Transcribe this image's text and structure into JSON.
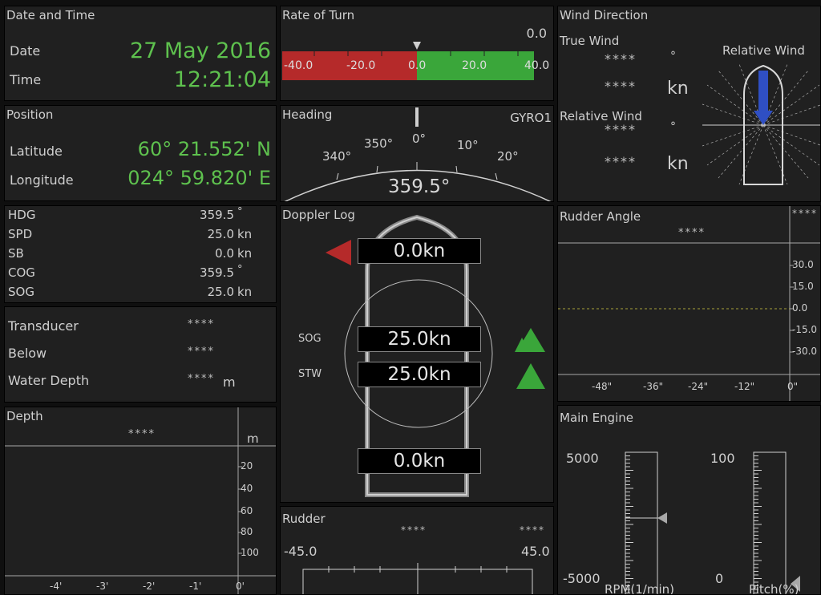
{
  "date_time": {
    "title": "Date and Time",
    "date_label": "Date",
    "date_value": "27 May 2016",
    "time_label": "Time",
    "time_value": "12:21:04"
  },
  "rate_of_turn": {
    "title": "Rate of Turn",
    "value": "0.0",
    "ticks": [
      "-40.0",
      "-20.0",
      "0.0",
      "20.0",
      "40.0"
    ],
    "bar_value": 0.0,
    "range": [
      -40,
      40
    ]
  },
  "wind": {
    "title": "Wind Direction",
    "true_label": "True Wind",
    "true_dir": "****",
    "deg": "°",
    "true_speed": "****",
    "unit": "kn",
    "rel_label": "Relative Wind",
    "rel_dir": "****",
    "rel_speed": "****",
    "rel_graphic_label": "Relative Wind"
  },
  "position": {
    "title": "Position",
    "lat_label": "Latitude",
    "lat_value": "60° 21.552' N",
    "lon_label": "Longitude",
    "lon_value": "024° 59.820' E"
  },
  "heading": {
    "title": "Heading",
    "source": "GYRO1",
    "value": "359.5°",
    "ticks": [
      "340°",
      "350°",
      "0°",
      "10°",
      "20°"
    ]
  },
  "nav": {
    "rows": [
      {
        "label": "HDG",
        "value": "359.5",
        "unit": "°"
      },
      {
        "label": "SPD",
        "value": "25.0",
        "unit": "kn"
      },
      {
        "label": "SB",
        "value": "0.0",
        "unit": "kn"
      },
      {
        "label": "COG",
        "value": "359.5",
        "unit": "°"
      },
      {
        "label": "SOG",
        "value": "25.0",
        "unit": "kn"
      }
    ]
  },
  "doppler": {
    "title": "Doppler Log",
    "bow": "0.0kn",
    "sog_label": "SOG",
    "sog": "25.0kn",
    "stw_label": "STW",
    "stw": "25.0kn",
    "stern": "0.0kn"
  },
  "rudder_angle": {
    "title": "Rudder Angle",
    "top": "****",
    "value": "****",
    "y_ticks": [
      "30.0",
      "15.0",
      "0.0",
      "-15.0",
      "-30.0"
    ],
    "x_ticks": [
      "-48\"",
      "-36\"",
      "-24\"",
      "-12\"",
      "0\""
    ]
  },
  "transducer": {
    "row1_label": "Transducer",
    "row1_value": "****",
    "row2_label": "Below",
    "row2_value": "****",
    "row3_label": "Water Depth",
    "row3_value": "****",
    "row3_unit": "m"
  },
  "depth": {
    "title": "Depth",
    "value": "****",
    "unit": "m",
    "y_ticks": [
      "20",
      "40",
      "60",
      "80",
      "100"
    ],
    "x_ticks": [
      "-4'",
      "-3'",
      "-2'",
      "-1'",
      "0'"
    ]
  },
  "main_engine": {
    "title": "Main Engine",
    "rpm_max": "5000",
    "rpm_min": "-5000",
    "rpm_label": "RPM(1/min)",
    "pitch_max": "100",
    "pitch_min": "0",
    "pitch_label": "Pitch(%)",
    "rpm_value": 0,
    "pitch_value": 0
  },
  "rudder": {
    "title": "Rudder",
    "value_left": "****",
    "value_right": "****",
    "left": "-45.0",
    "right": "45.0"
  },
  "colors": {
    "green": "#5ec14e",
    "red": "#b52a2a",
    "bar_green": "#3aa63a",
    "blue": "#2f4fc4"
  }
}
